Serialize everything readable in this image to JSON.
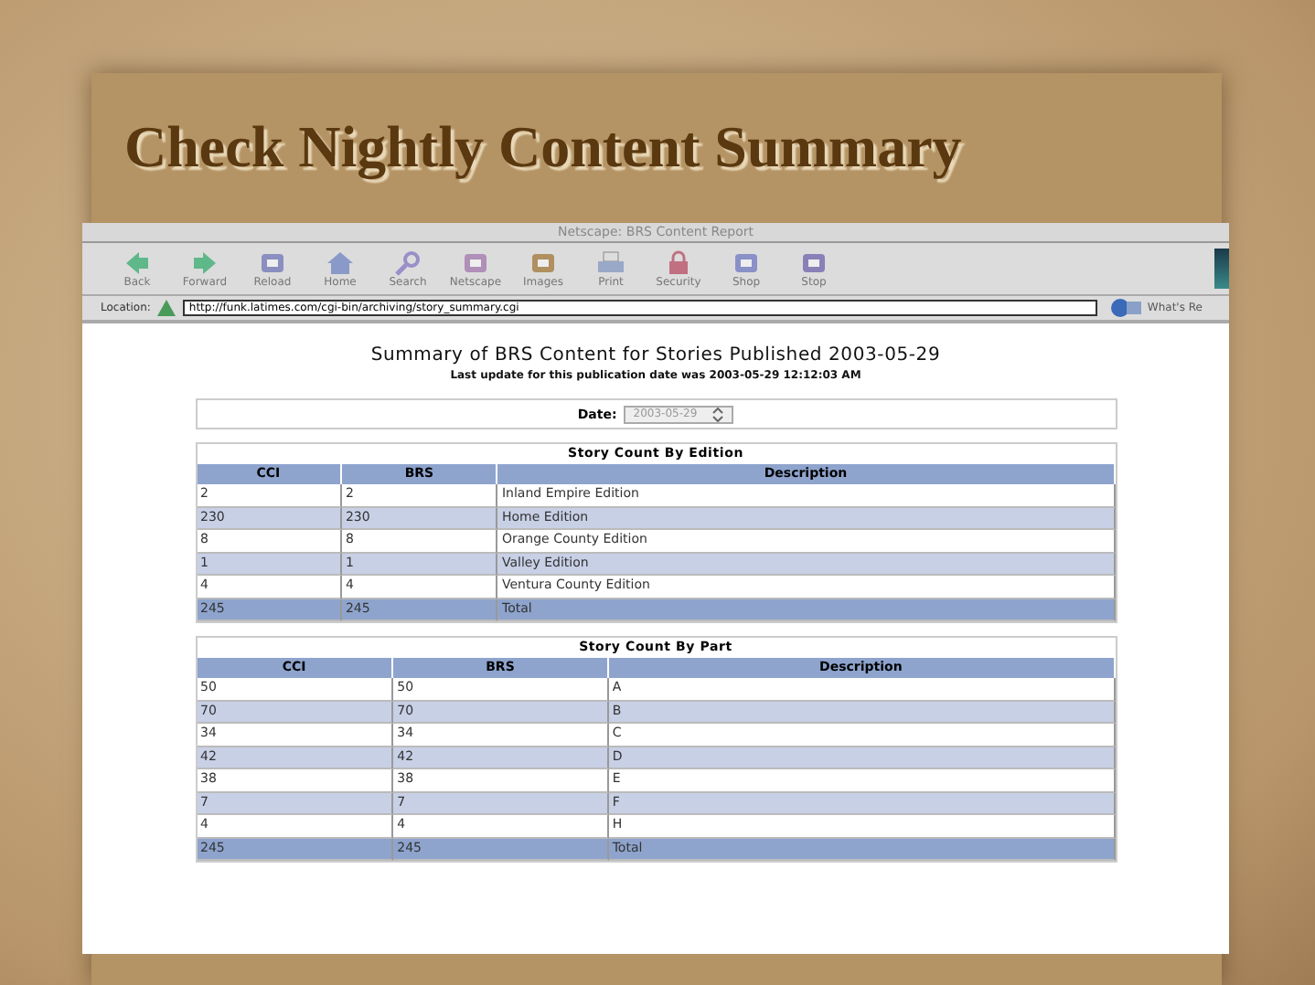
{
  "slide": {
    "title": "Check Nightly Content Summary"
  },
  "browser": {
    "window_title": "Netscape: BRS Content Report",
    "toolbar": [
      {
        "label": "Back",
        "kind": "back"
      },
      {
        "label": "Forward",
        "kind": "forward"
      },
      {
        "label": "Reload",
        "kind": "reload"
      },
      {
        "label": "Home",
        "kind": "home"
      },
      {
        "label": "Search",
        "kind": "search"
      },
      {
        "label": "Netscape",
        "kind": "netscape"
      },
      {
        "label": "Images",
        "kind": "images"
      },
      {
        "label": "Print",
        "kind": "print"
      },
      {
        "label": "Security",
        "kind": "security"
      },
      {
        "label": "Shop",
        "kind": "shop"
      },
      {
        "label": "Stop",
        "kind": "stop"
      }
    ],
    "location": {
      "label": "Location:",
      "url": "http://funk.latimes.com/cgi-bin/archiving/story_summary.cgi"
    },
    "whats_related": "What's Re"
  },
  "page": {
    "title": "Summary of BRS Content for Stories Published 2003-05-29",
    "subtitle": "Last update for this publication date was 2003-05-29 12:12:03 AM",
    "date_label": "Date:",
    "date_value": "2003-05-29",
    "tables": [
      {
        "title": "Story Count By Edition",
        "columns": [
          "CCI",
          "BRS",
          "Description"
        ],
        "rows": [
          {
            "kind": "data",
            "cells": [
              "2",
              "2",
              "Inland Empire Edition"
            ]
          },
          {
            "kind": "data",
            "cells": [
              "230",
              "230",
              "Home Edition"
            ]
          },
          {
            "kind": "data",
            "cells": [
              "8",
              "8",
              "Orange County Edition"
            ]
          },
          {
            "kind": "data",
            "cells": [
              "1",
              "1",
              "Valley Edition"
            ]
          },
          {
            "kind": "data",
            "cells": [
              "4",
              "4",
              "Ventura County Edition"
            ]
          },
          {
            "kind": "total",
            "cells": [
              "245",
              "245",
              "Total"
            ]
          }
        ]
      },
      {
        "title": "Story Count By Part",
        "columns": [
          "CCI",
          "BRS",
          "Description"
        ],
        "rows": [
          {
            "kind": "data",
            "cells": [
              "50",
              "50",
              "A"
            ]
          },
          {
            "kind": "data",
            "cells": [
              "70",
              "70",
              "B"
            ]
          },
          {
            "kind": "data",
            "cells": [
              "34",
              "34",
              "C"
            ]
          },
          {
            "kind": "data",
            "cells": [
              "42",
              "42",
              "D"
            ]
          },
          {
            "kind": "data",
            "cells": [
              "38",
              "38",
              "E"
            ]
          },
          {
            "kind": "data",
            "cells": [
              "7",
              "7",
              "F"
            ]
          },
          {
            "kind": "data",
            "cells": [
              "4",
              "4",
              "H"
            ]
          },
          {
            "kind": "total",
            "cells": [
              "245",
              "245",
              "Total"
            ]
          }
        ]
      }
    ]
  }
}
